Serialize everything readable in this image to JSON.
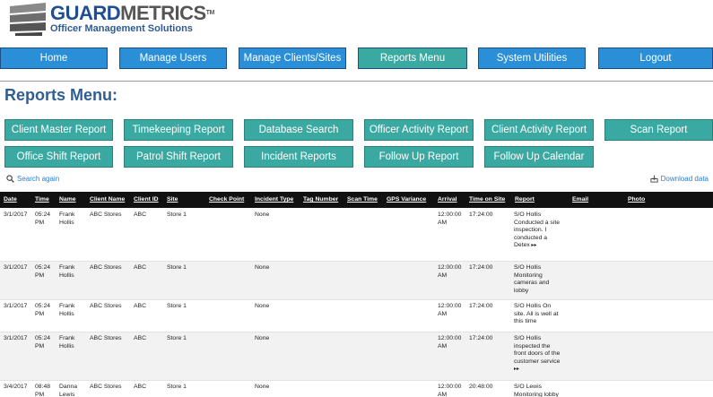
{
  "brand": {
    "name_main": "GUARD",
    "name_accent": "METRICS",
    "tm": "TM",
    "tagline": "Officer Management Solutions"
  },
  "nav": {
    "home": "Home",
    "manage_users": "Manage Users",
    "manage_clients": "Manage Clients/Sites",
    "reports_menu": "Reports Menu",
    "system_utilities": "System Utilities",
    "logout": "Logout"
  },
  "page_title": "Reports Menu:",
  "reports": {
    "client_master": "Client Master Report",
    "timekeeping": "Timekeeping Report",
    "database_search": "Database Search",
    "officer_activity": "Officer Activity Report",
    "client_activity": "Client Activity Report",
    "scan": "Scan Report",
    "office_shift": "Office Shift Report",
    "patrol_shift": "Patrol Shift Report",
    "incident": "Incident Reports",
    "follow_up": "Follow Up Report",
    "follow_up_calendar": "Follow Up Calendar"
  },
  "actions": {
    "search_again": "Search again",
    "download": "Download data"
  },
  "table": {
    "columns": {
      "date": "Date",
      "time": "Time",
      "name": "Name",
      "client_name": "Client Name",
      "client_id": "Client ID",
      "site": "Site",
      "check_point": "Check Point",
      "incident_type": "Incident Type",
      "tag_number": "Tag Number",
      "scan_time": "Scan Time",
      "gps_variance": "GPS Variance",
      "arrival": "Arrival",
      "time_on_site": "Time on Site",
      "report": "Report",
      "email": "Email",
      "photo": "Photo"
    },
    "rows": [
      {
        "date": "3/1/2017",
        "time1": "05:24",
        "time2": "PM",
        "name1": "Frank",
        "name2": "Hollis",
        "client_name": "ABC Stores",
        "client_id": "ABC",
        "site": "Store 1",
        "incident_type": "None",
        "arrival1": "12:00:00",
        "arrival2": "AM",
        "time_on_site": "17:24:00",
        "report": [
          "S/O Hollis",
          "Conducted a site",
          "inspection. I",
          "conducted a",
          "Detex"
        ],
        "more": "▸▸"
      },
      {
        "date": "3/1/2017",
        "time1": "05:24",
        "time2": "PM",
        "name1": "Frank",
        "name2": "Hollis",
        "client_name": "ABC Stores",
        "client_id": "ABC",
        "site": "Store 1",
        "incident_type": "None",
        "arrival1": "12:00:00",
        "arrival2": "AM",
        "time_on_site": "17:24:00",
        "report": [
          "S/O Hollis",
          "Monitoring",
          "cameras and",
          "lobby"
        ]
      },
      {
        "date": "3/1/2017",
        "time1": "05:24",
        "time2": "PM",
        "name1": "Frank",
        "name2": "Hollis",
        "client_name": "ABC Stores",
        "client_id": "ABC",
        "site": "Store 1",
        "incident_type": "None",
        "arrival1": "12:00:00",
        "arrival2": "AM",
        "time_on_site": "17:24:00",
        "report": [
          "S/O Hollis On",
          "site. All is well at",
          "this time"
        ]
      },
      {
        "date": "3/1/2017",
        "time1": "05:24",
        "time2": "PM",
        "name1": "Frank",
        "name2": "Hollis",
        "client_name": "ABC Stores",
        "client_id": "ABC",
        "site": "Store 1",
        "incident_type": "None",
        "arrival1": "12:00:00",
        "arrival2": "AM",
        "time_on_site": "17:24:00",
        "report": [
          "S/O Hollis",
          "inspected the",
          "front doors of the",
          "customer service"
        ],
        "more": "▸▸"
      },
      {
        "date": "3/4/2017",
        "time1": "08:48",
        "time2": "PM",
        "name1": "Danna",
        "name2": "Lewis",
        "client_name": "ABC Stores",
        "client_id": "ABC",
        "site": "Store 1",
        "incident_type": "None",
        "arrival1": "12:00:00",
        "arrival2": "AM",
        "time_on_site": "20:48:00",
        "report": [
          "S/O Lewis",
          "Monitoring lobby"
        ]
      }
    ]
  },
  "colors": {
    "nav_blue": "#2a8fd6",
    "teal": "#3aa9a1",
    "title_blue": "#2f5f92",
    "link_blue": "#2a7ed0",
    "table_header": "#111111"
  }
}
